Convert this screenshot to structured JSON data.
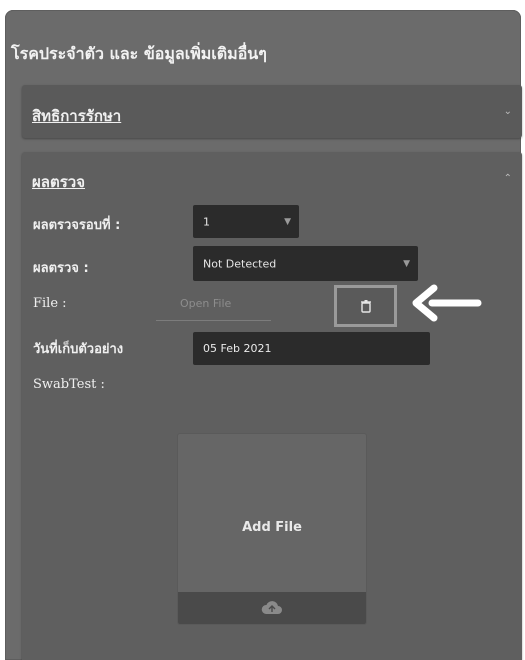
{
  "page_title": "โรคประจำตัว และ ข้อมูลเพิ่มเติมอื่นๆ",
  "sections": {
    "rights": {
      "title": "สิทธิการรักษา"
    },
    "results": {
      "title": "ผลตรวจ",
      "round_label": "ผลตรวจรอบที่ :",
      "round_value": "1",
      "result_label": "ผลตรวจ :",
      "result_value": "Not Detected",
      "file_label": "File :",
      "file_placeholder": "Open File",
      "date_label": "วันที่เก็บตัวอย่าง",
      "date_value": "05 Feb 2021",
      "swab_label": "SwabTest :",
      "add_file_label": "Add File"
    }
  },
  "icons": {
    "trash": "trash-icon",
    "upload": "cloud-upload-icon",
    "arrow": "arrow-left-icon",
    "chevron_down": "chevron-down-icon",
    "chevron_up": "chevron-up-icon"
  },
  "colors": {
    "panel_bg": "#6b6b6b",
    "field_bg": "#2b2b2b",
    "highlight_frame": "#9a9a9a",
    "arrow": "#ffffff"
  }
}
